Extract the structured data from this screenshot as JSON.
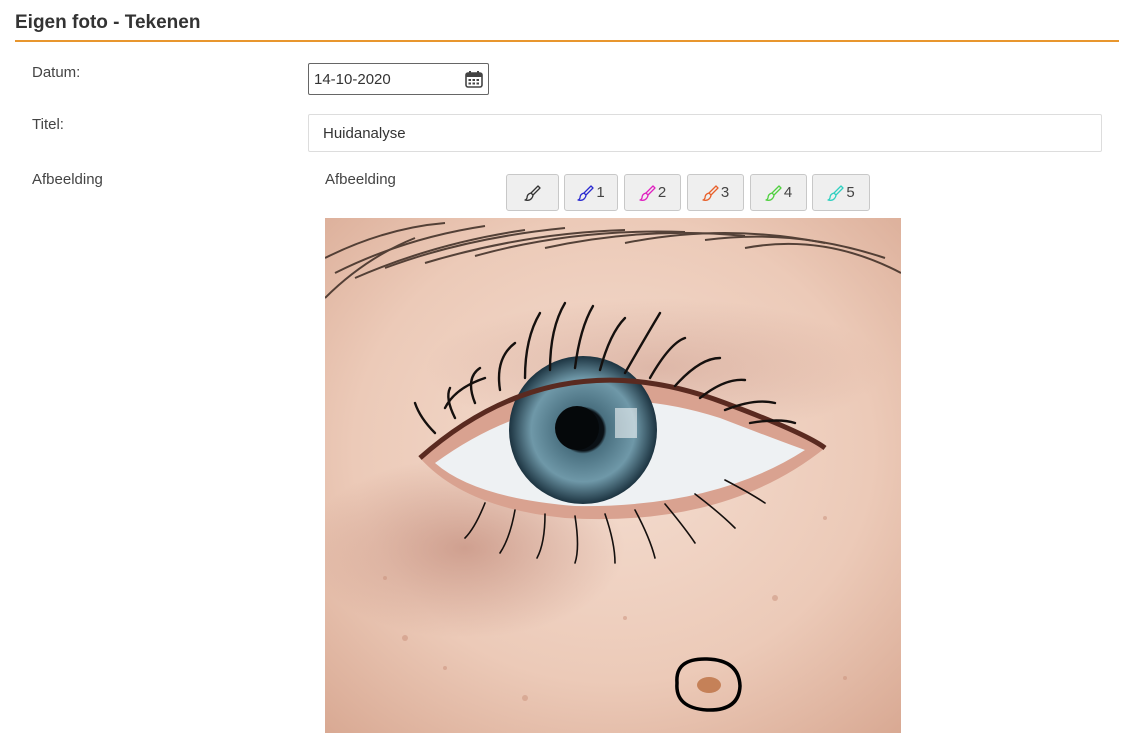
{
  "header": {
    "title": "Eigen foto - Tekenen",
    "accent_color": "#e8962e"
  },
  "form": {
    "datum_label": "Datum:",
    "datum_value": "14-10-2020",
    "titel_label": "Titel:",
    "titel_value": "Huidanalyse",
    "afbeelding_label": "Afbeelding",
    "afbeelding_sublabel": "Afbeelding"
  },
  "toolbar": {
    "buttons": [
      {
        "label": "",
        "icon": "brush-icon",
        "color": "#333333"
      },
      {
        "label": "1",
        "icon": "brush-icon",
        "color": "#2a2ad0"
      },
      {
        "label": "2",
        "icon": "brush-icon",
        "color": "#e020c0"
      },
      {
        "label": "3",
        "icon": "brush-icon",
        "color": "#e8602a"
      },
      {
        "label": "4",
        "icon": "brush-icon",
        "color": "#50d040"
      },
      {
        "label": "5",
        "icon": "brush-icon",
        "color": "#30d0c0"
      }
    ]
  },
  "canvas": {
    "image": "eye-photo",
    "annotation": "black-circle"
  }
}
